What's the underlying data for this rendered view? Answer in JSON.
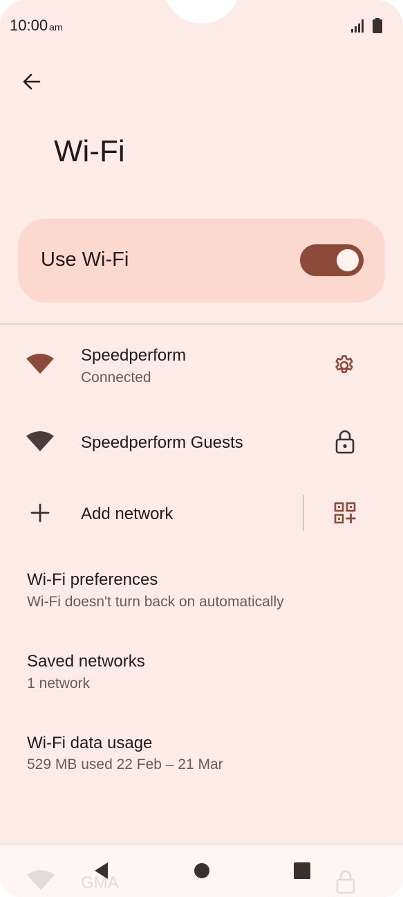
{
  "status_bar": {
    "time": "10:00",
    "ampm": "am",
    "icons": [
      "signal-icon",
      "battery-icon"
    ]
  },
  "header": {
    "back_icon": "arrow-back-icon",
    "title": "Wi-Fi"
  },
  "master_toggle": {
    "label": "Use Wi-Fi",
    "on": true
  },
  "networks": [
    {
      "name": "Speedperform",
      "status": "Connected",
      "icon": "wifi-icon",
      "action_icon": "gear-icon"
    },
    {
      "name": "Speedperform Guests",
      "icon": "wifi-icon",
      "action_icon": "lock-icon"
    }
  ],
  "add_network": {
    "label": "Add network",
    "icon": "plus-icon",
    "qr_icon": "qr-code-scan-icon"
  },
  "preferences": [
    {
      "title": "Wi-Fi preferences",
      "summary": "Wi-Fi doesn't turn back on automatically"
    },
    {
      "title": "Saved networks",
      "summary": "1 network"
    },
    {
      "title": "Wi-Fi data usage",
      "summary": "529 MB used 22 Feb – 21 Mar"
    }
  ],
  "partially_hidden_network": {
    "name": "GMA"
  },
  "nav_bar": {
    "icons": [
      "back-triangle-icon",
      "home-circle-icon",
      "recents-square-icon"
    ]
  },
  "colors": {
    "background": "#fcebe6",
    "accent": "#8c4a39",
    "toggle_card": "#fcd9cf"
  }
}
